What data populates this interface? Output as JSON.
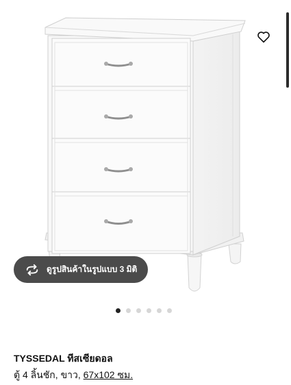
{
  "product": {
    "image_alt": "TYSSEDAL white chest of 4 drawers",
    "view_3d_label": "ดูรูปสินค้าในรูปแบบ 3 มิติ",
    "carousel": {
      "total": 6,
      "active": 1
    },
    "name": "TYSSEDAL ทีสเซียดอล",
    "description_prefix": "ตู้ 4 ลิ้นชัก, ขาว, ",
    "dimensions_link": "67x102 ซม."
  },
  "icons": {
    "favorite": "heart-outline-icon",
    "view_3d": "rotate-3d-icon"
  },
  "colors": {
    "furniture": "#f7f7f7",
    "button_bg": "#4b4b4b",
    "dot_active": "#222222",
    "dot_inactive": "#d6d6d6"
  }
}
